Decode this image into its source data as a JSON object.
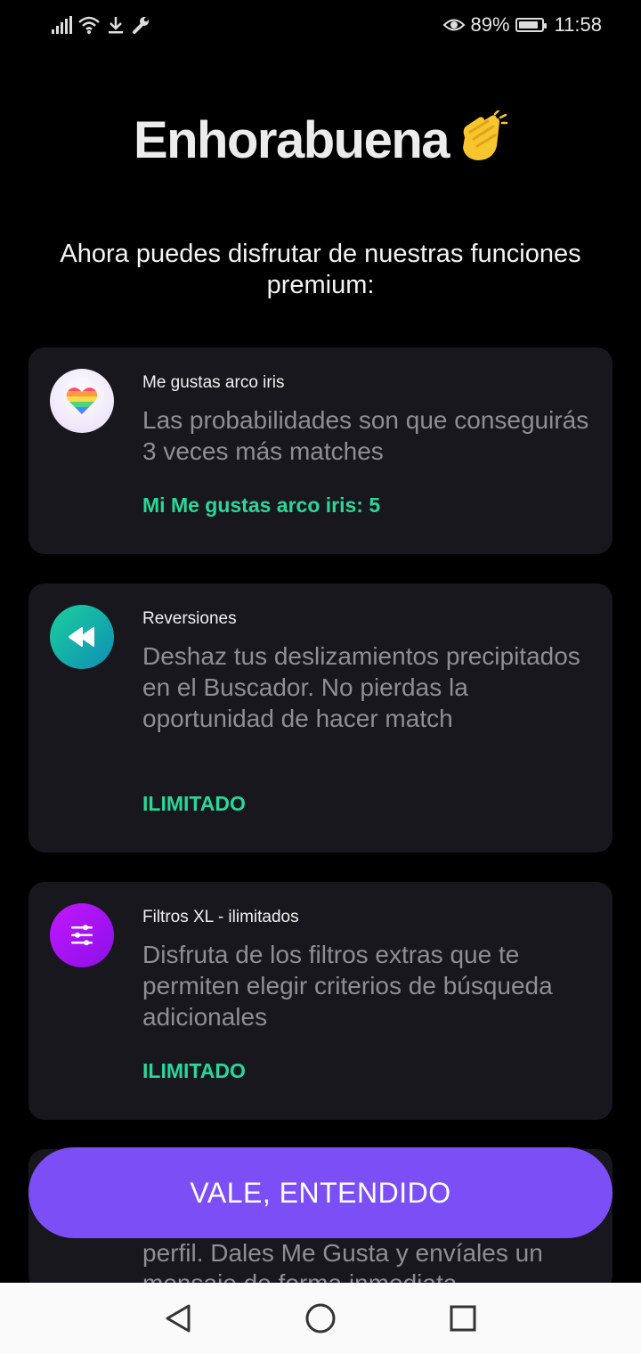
{
  "status_bar": {
    "battery_percent": "89%",
    "battery_level": 0.89,
    "time": "11:58",
    "icons": [
      "signal-icon",
      "wifi-icon",
      "download-icon",
      "wrench-icon",
      "eye-icon",
      "battery-icon"
    ]
  },
  "header": {
    "title": "Enhorabuena",
    "emoji_icon": "clapping-hands-icon"
  },
  "subtitle": "Ahora puedes disfrutar de nuestras funciones premium:",
  "features": [
    {
      "icon": "rainbow-heart-icon",
      "title": "Me gustas arco iris",
      "description": "Las probabilidades son que conseguirás 3 veces más matches",
      "status": "Mi Me gustas arco iris: 5"
    },
    {
      "icon": "rewind-icon",
      "title": "Reversiones",
      "description": "Deshaz tus deslizamientos precipitados en el Buscador. No pierdas la oportunidad de hacer match",
      "status": "ILIMITADO"
    },
    {
      "icon": "filters-icon",
      "title": "Filtros XL - ilimitados",
      "description": "Disfruta de los filtros extras que te permiten elegir criterios de búsqueda adicionales",
      "status": "ILIMITADO"
    }
  ],
  "partial_card_text": "perfil. Dales Me Gusta y envíales un mensaje de forma inmediata",
  "cta_label": "VALE, ENTENDIDO",
  "colors": {
    "background": "#000000",
    "card": "#18171d",
    "accent_green": "#2ad79a",
    "cta_purple": "#7b4ff5",
    "rewind_gradient": [
      "#1ccf9b",
      "#0e8fb8"
    ],
    "filters_gradient": [
      "#c317ff",
      "#8a10e6"
    ]
  },
  "nav_bar": {
    "buttons": [
      "back-icon",
      "home-icon",
      "recents-icon"
    ]
  }
}
